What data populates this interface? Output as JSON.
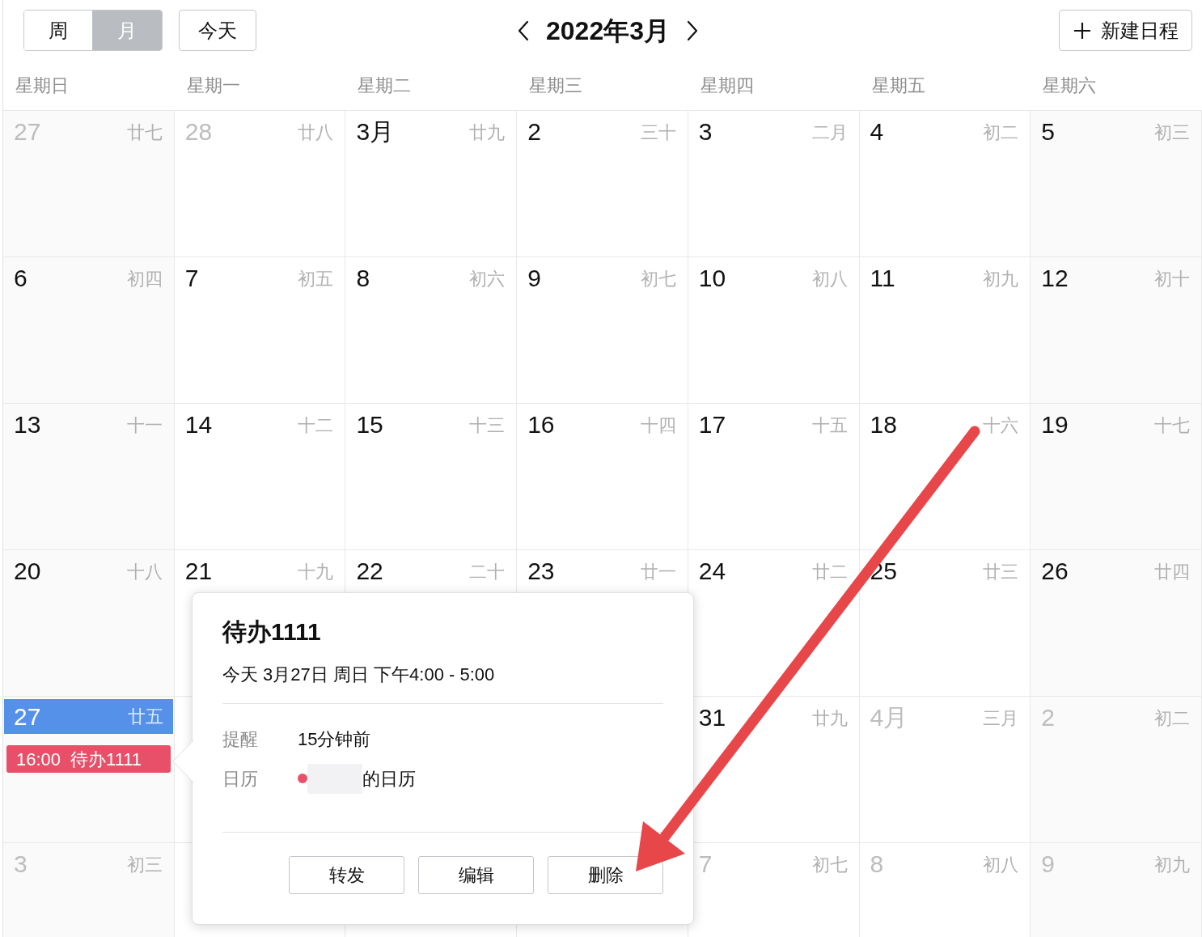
{
  "toolbar": {
    "view_switch": [
      {
        "label": "周",
        "selected": false
      },
      {
        "label": "月",
        "selected": true
      }
    ],
    "today_button": "今天",
    "title": "2022年3月",
    "new_button": "新建日程"
  },
  "weekdays": [
    "星期日",
    "星期一",
    "星期二",
    "星期三",
    "星期四",
    "星期五",
    "星期六"
  ],
  "weeks": [
    {
      "days": [
        {
          "kind": "day",
          "date": "27",
          "lunar": "廿七",
          "outside_month": true,
          "today": false
        },
        {
          "kind": "day",
          "date": "28",
          "lunar": "廿八",
          "outside_month": true,
          "today": false
        },
        {
          "kind": "day",
          "date": "3月",
          "lunar": "廿九",
          "outside_month": false,
          "today": false
        },
        {
          "kind": "day",
          "date": "2",
          "lunar": "三十",
          "outside_month": false,
          "today": false
        },
        {
          "kind": "day",
          "date": "3",
          "lunar": "二月",
          "outside_month": false,
          "today": false
        },
        {
          "kind": "day",
          "date": "4",
          "lunar": "初二",
          "outside_month": false,
          "today": false
        },
        {
          "kind": "day",
          "date": "5",
          "lunar": "初三",
          "outside_month": false,
          "today": false
        }
      ]
    },
    {
      "days": [
        {
          "kind": "day",
          "date": "6",
          "lunar": "初四",
          "outside_month": false,
          "today": false
        },
        {
          "kind": "day",
          "date": "7",
          "lunar": "初五",
          "outside_month": false,
          "today": false
        },
        {
          "kind": "day",
          "date": "8",
          "lunar": "初六",
          "outside_month": false,
          "today": false
        },
        {
          "kind": "day",
          "date": "9",
          "lunar": "初七",
          "outside_month": false,
          "today": false
        },
        {
          "kind": "day",
          "date": "10",
          "lunar": "初八",
          "outside_month": false,
          "today": false
        },
        {
          "kind": "day",
          "date": "11",
          "lunar": "初九",
          "outside_month": false,
          "today": false
        },
        {
          "kind": "day",
          "date": "12",
          "lunar": "初十",
          "outside_month": false,
          "today": false
        }
      ]
    },
    {
      "days": [
        {
          "kind": "day",
          "date": "13",
          "lunar": "十一",
          "outside_month": false,
          "today": false
        },
        {
          "kind": "day",
          "date": "14",
          "lunar": "十二",
          "outside_month": false,
          "today": false
        },
        {
          "kind": "day",
          "date": "15",
          "lunar": "十三",
          "outside_month": false,
          "today": false
        },
        {
          "kind": "day",
          "date": "16",
          "lunar": "十四",
          "outside_month": false,
          "today": false
        },
        {
          "kind": "day",
          "date": "17",
          "lunar": "十五",
          "outside_month": false,
          "today": false
        },
        {
          "kind": "day",
          "date": "18",
          "lunar": "十六",
          "outside_month": false,
          "today": false
        },
        {
          "kind": "day",
          "date": "19",
          "lunar": "十七",
          "outside_month": false,
          "today": false
        }
      ]
    },
    {
      "days": [
        {
          "kind": "day",
          "date": "20",
          "lunar": "十八",
          "outside_month": false,
          "today": false
        },
        {
          "kind": "day",
          "date": "21",
          "lunar": "十九",
          "outside_month": false,
          "today": false
        },
        {
          "kind": "day",
          "date": "22",
          "lunar": "二十",
          "outside_month": false,
          "today": false
        },
        {
          "kind": "day",
          "date": "23",
          "lunar": "廿一",
          "outside_month": false,
          "today": false
        },
        {
          "kind": "day",
          "date": "24",
          "lunar": "廿二",
          "outside_month": false,
          "today": false
        },
        {
          "kind": "day",
          "date": "25",
          "lunar": "廿三",
          "outside_month": false,
          "today": false
        },
        {
          "kind": "day",
          "date": "26",
          "lunar": "廿四",
          "outside_month": false,
          "today": false
        }
      ]
    },
    {
      "days": [
        {
          "kind": "day",
          "date": "27",
          "lunar": "廿五",
          "outside_month": false,
          "today": true,
          "events": [
            {
              "time": "16:00",
              "title": "待办1111",
              "color": "#e8506a"
            }
          ]
        },
        {
          "kind": "covered"
        },
        {
          "kind": "covered"
        },
        {
          "kind": "covered"
        },
        {
          "kind": "day",
          "date": "31",
          "lunar": "廿九",
          "outside_month": false,
          "today": false
        },
        {
          "kind": "day",
          "date": "4月",
          "lunar": "三月",
          "outside_month": true,
          "today": false
        },
        {
          "kind": "day",
          "date": "2",
          "lunar": "初二",
          "outside_month": true,
          "today": false
        }
      ]
    },
    {
      "days": [
        {
          "kind": "day",
          "date": "3",
          "lunar": "初三",
          "outside_month": true,
          "today": false
        },
        {
          "kind": "covered"
        },
        {
          "kind": "covered"
        },
        {
          "kind": "covered"
        },
        {
          "kind": "day",
          "date": "7",
          "lunar": "初七",
          "outside_month": true,
          "today": false
        },
        {
          "kind": "day",
          "date": "8",
          "lunar": "初八",
          "outside_month": true,
          "today": false
        },
        {
          "kind": "day",
          "date": "9",
          "lunar": "初九",
          "outside_month": true,
          "today": false
        }
      ]
    }
  ],
  "event_popup": {
    "title": "待办1111",
    "when": "今天 3月27日 周日 下午4:00 - 5:00",
    "details": [
      {
        "kind": "text",
        "label": "提醒",
        "value": "15分钟前"
      },
      {
        "kind": "calendar",
        "label": "日历",
        "value": "的日历",
        "color": "#e8506a"
      }
    ],
    "buttons": [
      "转发",
      "编辑",
      "删除"
    ]
  }
}
